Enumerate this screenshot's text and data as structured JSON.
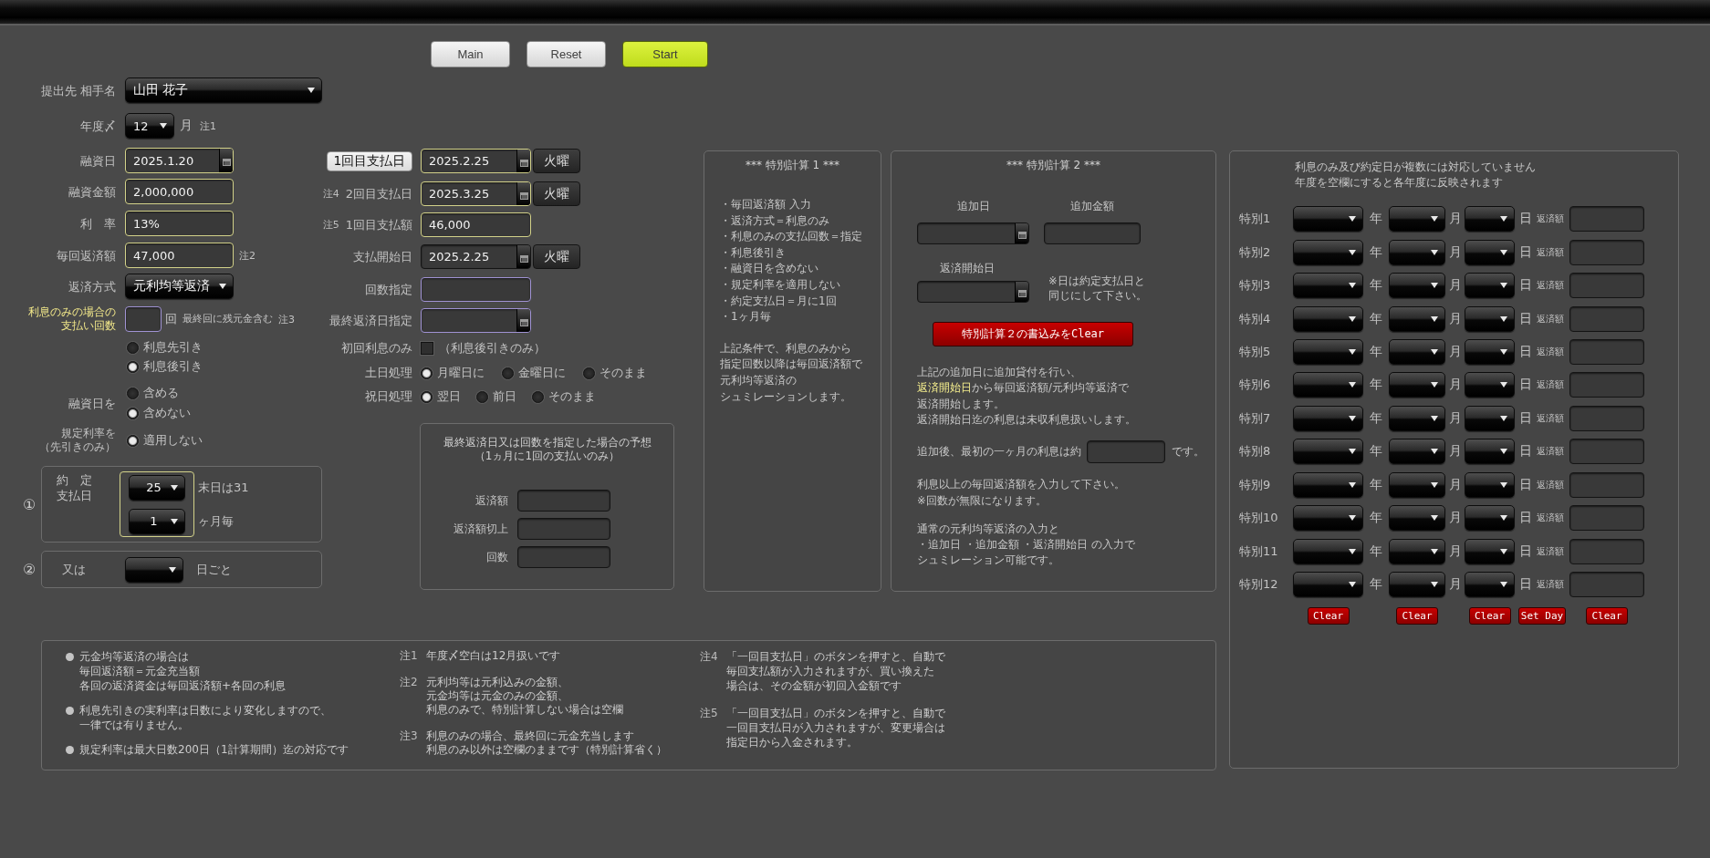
{
  "toolbar": [
    {
      "label": "Main",
      "kind": "plain"
    },
    {
      "label": "Reset",
      "kind": "plain"
    },
    {
      "label": "Start",
      "kind": "primary"
    }
  ],
  "basic": {
    "recipient": {
      "label": "提出先 相手名",
      "value": "山田 花子"
    },
    "fiscal_month": {
      "label": "年度〆",
      "value": "12",
      "unit": "月",
      "note": "注1"
    },
    "loan_date": {
      "label": "融資日",
      "value": "2025.1.20"
    },
    "loan_amount": {
      "label": "融資金額",
      "value": "2,000,000"
    },
    "interest_rate": {
      "label": "利　率",
      "value": "13%"
    },
    "installment": {
      "label": "毎回返済額",
      "value": "47,000",
      "note": "注2"
    },
    "repayment_method": {
      "label": "返済方式",
      "value": "元利均等返済"
    },
    "interest_only_count": {
      "label": [
        "利息のみの場合の",
        "支払い回数"
      ],
      "unit": "回",
      "hint": "最終回に残元金含む",
      "note": "注3"
    },
    "interest_timing": {
      "options": [
        {
          "label": "利息先引き",
          "selected": false
        },
        {
          "label": "利息後引き",
          "selected": true
        }
      ]
    },
    "loan_day": {
      "label": "融資日を",
      "options": [
        {
          "label": "含める",
          "selected": false
        },
        {
          "label": "含めない",
          "selected": true
        }
      ]
    },
    "statutory_rate": {
      "label": [
        "規定利率を",
        "（先引きのみ）"
      ],
      "options": [
        {
          "label": "適用しない",
          "selected": true
        }
      ]
    },
    "payment_day": {
      "marker": "①",
      "label": [
        "約　定",
        "支払日"
      ],
      "day": "25",
      "day_hint": "末日は31",
      "interval": "1",
      "interval_unit": "ヶ月毎"
    },
    "day_interval": {
      "marker": "②",
      "label": "又は",
      "unit": "日ごと"
    }
  },
  "schedule": {
    "first_payment": {
      "button": "1回目支払日",
      "value": "2025.2.25",
      "weekday": "火曜"
    },
    "second_payment": {
      "note": "注4",
      "label": "2回目支払日",
      "value": "2025.3.25",
      "weekday": "火曜"
    },
    "first_amount": {
      "note": "注5",
      "label": "1回目支払額",
      "value": "46,000"
    },
    "start_date": {
      "label": "支払開始日",
      "value": "2025.2.25",
      "weekday": "火曜"
    },
    "count": {
      "label": "回数指定"
    },
    "final_date": {
      "label": "最終返済日指定"
    },
    "first_interest_only": {
      "label": "初回利息のみ",
      "checked": false,
      "hint": "（利息後引きのみ）"
    },
    "weekend": {
      "label": "土日処理",
      "options": [
        {
          "label": "月曜日に",
          "selected": true
        },
        {
          "label": "金曜日に",
          "selected": false
        },
        {
          "label": "そのまま",
          "selected": false
        }
      ]
    },
    "holiday": {
      "label": "祝日処理",
      "options": [
        {
          "label": "翌日",
          "selected": true
        },
        {
          "label": "前日",
          "selected": false
        },
        {
          "label": "そのまま",
          "selected": false
        }
      ]
    },
    "forecast": {
      "title": [
        "最終返済日又は回数を指定した場合の予想",
        "（1ヵ月に1回の支払いのみ）"
      ],
      "fields": [
        {
          "label": "返済額"
        },
        {
          "label": "返済額切上"
        },
        {
          "label": "回数"
        }
      ]
    }
  },
  "special_1": {
    "title": "*** 特別計算 1 ***",
    "conditions": [
      "・毎回返済額 入力",
      "・返済方式＝利息のみ",
      "・利息のみの支払回数＝指定",
      "・利息後引き",
      "・融資日を含めない",
      "・規定利率を適用しない",
      "・約定支払日＝月に1回",
      "・1ヶ月毎"
    ],
    "description": [
      "上記条件で、利息のみから",
      "指定回数以降は毎回返済額で",
      "元利均等返済の",
      "シュミレーションします。"
    ]
  },
  "special_2": {
    "title": "*** 特別計算 2 ***",
    "add_date": {
      "label": "追加日"
    },
    "add_amount": {
      "label": "追加金額"
    },
    "start_date": {
      "label": "返済開始日",
      "note": [
        "※日は約定支払日と",
        "同じにして下さい。"
      ]
    },
    "clear_button": "特別計算２の書込みをClear",
    "description": [
      "上記の追加日に追加貸付を行い、",
      "**返済開始日**から毎回返済額/元利均等返済で",
      "返済開始します。",
      "返済開始日迄の利息は未収利息扱いします。"
    ],
    "interest_estimate": {
      "before": "追加後、最初の一ヶ月の利息は約",
      "after": "です。"
    },
    "warning": [
      "利息以上の毎回返済額を入力して下さい。",
      "※回数が無限になります。"
    ],
    "usage": [
      "通常の元利均等返済の入力と",
      "・追加日 ・追加金額 ・返済開始日 の入力で",
      "シュミレーション可能です。"
    ]
  },
  "special_days": {
    "header": [
      "利息のみ及び約定日が複数には対応していません",
      "年度を空欄にすると各年度に反映されます"
    ],
    "rows": [
      {
        "label": "特別1",
        "year_unit": "年",
        "month_unit": "月",
        "day_unit": "日",
        "amount_label": "返済額"
      },
      {
        "label": "特別2",
        "year_unit": "年",
        "month_unit": "月",
        "day_unit": "日",
        "amount_label": "返済額"
      },
      {
        "label": "特別3",
        "year_unit": "年",
        "month_unit": "月",
        "day_unit": "日",
        "amount_label": "返済額"
      },
      {
        "label": "特別4",
        "year_unit": "年",
        "month_unit": "月",
        "day_unit": "日",
        "amount_label": "返済額"
      },
      {
        "label": "特別5",
        "year_unit": "年",
        "month_unit": "月",
        "day_unit": "日",
        "amount_label": "返済額"
      },
      {
        "label": "特別6",
        "year_unit": "年",
        "month_unit": "月",
        "day_unit": "日",
        "amount_label": "返済額"
      },
      {
        "label": "特別7",
        "year_unit": "年",
        "month_unit": "月",
        "day_unit": "日",
        "amount_label": "返済額"
      },
      {
        "label": "特別8",
        "year_unit": "年",
        "month_unit": "月",
        "day_unit": "日",
        "amount_label": "返済額"
      },
      {
        "label": "特別9",
        "year_unit": "年",
        "month_unit": "月",
        "day_unit": "日",
        "amount_label": "返済額"
      },
      {
        "label": "特別10",
        "year_unit": "年",
        "month_unit": "月",
        "day_unit": "日",
        "amount_label": "返済額"
      },
      {
        "label": "特別11",
        "year_unit": "年",
        "month_unit": "月",
        "day_unit": "日",
        "amount_label": "返済額"
      },
      {
        "label": "特別12",
        "year_unit": "年",
        "month_unit": "月",
        "day_unit": "日",
        "amount_label": "返済額"
      }
    ],
    "buttons": [
      "Clear",
      "Clear",
      "Clear",
      "Set Day",
      "Clear"
    ]
  },
  "notes": {
    "bullets": [
      [
        "元金均等返済の場合は",
        "毎回返済額＝元金充当額",
        "各回の返済資金は毎回返済額+各回の利息"
      ],
      [
        "利息先引きの実利率は日数により変化しますので、",
        "一律では有りません。"
      ],
      [
        "規定利率は最大日数200日（1計算期間）迄の対応です"
      ]
    ],
    "notes_a": [
      {
        "mark": "注1",
        "lines": [
          "年度〆空白は12月扱いです"
        ]
      },
      {
        "mark": "注2",
        "lines": [
          "元利均等は元利込みの金額、",
          "元金均等は元金のみの金額、",
          "利息のみで、特別計算しない場合は空欄"
        ]
      },
      {
        "mark": "注3",
        "lines": [
          "利息のみの場合、最終回に元金充当します",
          "利息のみ以外は空欄のままです（特別計算省く）"
        ]
      }
    ],
    "notes_b": [
      {
        "mark": "注4",
        "lines": [
          "「一回目支払日」のボタンを押すと、自動で",
          "毎回支払額が入力されますが、買い換えた",
          "場合は、その金額が初回入金額です"
        ]
      },
      {
        "mark": "注5",
        "lines": [
          "「一回目支払日」のボタンを押すと、自動で",
          "一回目支払日が入力されますが、変更場合は",
          "指定日から入金されます。"
        ]
      }
    ]
  }
}
